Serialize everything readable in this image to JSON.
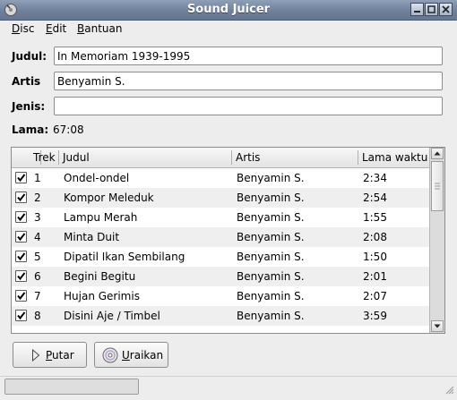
{
  "window": {
    "title": "Sound Juicer"
  },
  "menu": [
    {
      "label": "Disc",
      "mnemonic": "D",
      "rest": "isc"
    },
    {
      "label": "Edit",
      "mnemonic": "E",
      "rest": "dit"
    },
    {
      "label": "Bantuan",
      "mnemonic": "B",
      "rest": "antuan"
    }
  ],
  "form": {
    "title_label": "Judul:",
    "title_value": "In Memoriam 1939-1995",
    "artist_label": "Artis",
    "artist_value": "Benyamin S.",
    "genre_label": "Jenis:",
    "genre_value": "",
    "duration_label": "Lama:",
    "duration_value": "67:08"
  },
  "table": {
    "headers": {
      "track": "Trek",
      "title": "Judul",
      "artist": "Artis",
      "duration": "Lama waktu"
    },
    "rows": [
      {
        "checked": true,
        "track": "1",
        "title": "Ondel-ondel",
        "artist": "Benyamin S.",
        "duration": "2:34"
      },
      {
        "checked": true,
        "track": "2",
        "title": "Kompor Meleduk",
        "artist": "Benyamin S.",
        "duration": "2:54"
      },
      {
        "checked": true,
        "track": "3",
        "title": "Lampu Merah",
        "artist": "Benyamin S.",
        "duration": "1:55"
      },
      {
        "checked": true,
        "track": "4",
        "title": "Minta Duit",
        "artist": "Benyamin S.",
        "duration": "2:08"
      },
      {
        "checked": true,
        "track": "5",
        "title": "Dipatil Ikan Sembilang",
        "artist": "Benyamin S.",
        "duration": "1:50"
      },
      {
        "checked": true,
        "track": "6",
        "title": "Begini Begitu",
        "artist": "Benyamin S.",
        "duration": "2:01"
      },
      {
        "checked": true,
        "track": "7",
        "title": "Hujan Gerimis",
        "artist": "Benyamin S.",
        "duration": "2:07"
      },
      {
        "checked": true,
        "track": "8",
        "title": "Disini Aje / Timbel",
        "artist": "Benyamin S.",
        "duration": "3:59"
      }
    ]
  },
  "buttons": {
    "play": {
      "mnemonic": "P",
      "rest": "utar",
      "icon": "play-icon"
    },
    "extract": {
      "mnemonic": "U",
      "rest": "raikan",
      "icon": "cd-icon"
    }
  },
  "colors": {
    "titlebar": "#7183a0",
    "check": "#000000"
  }
}
